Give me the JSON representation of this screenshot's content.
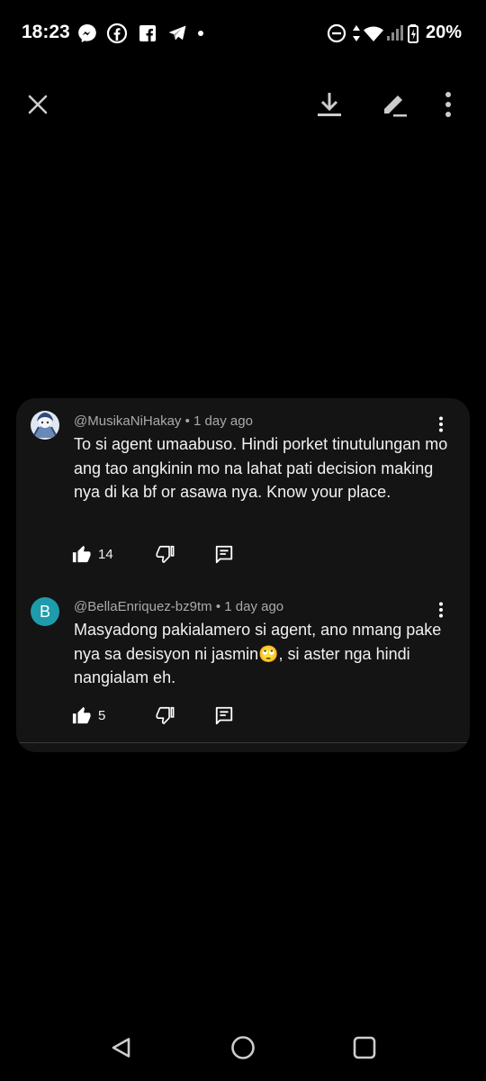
{
  "status_bar": {
    "time": "18:23",
    "notification_icons": [
      "messenger-icon",
      "facebook-icon",
      "facebook-pages-icon",
      "telegram-icon",
      "dot-icon"
    ],
    "system_icons": [
      "dnd-icon",
      "data-arrows-icon",
      "wifi-icon",
      "signal-icon",
      "battery-icon"
    ],
    "battery": "20%"
  },
  "toolbar": {
    "close_icon": "close-icon",
    "download_icon": "download-icon",
    "edit_icon": "edit-icon",
    "more_icon": "more-vert-icon"
  },
  "comments": [
    {
      "author": "@MusikaNiHakay",
      "age": "1 day ago",
      "avatar": "image",
      "text": "To si agent umaabuso.  Hindi porket tinutulungan mo ang tao angkinin mo na lahat pati decision making nya di ka bf or asawa nya.  Know your place.",
      "likes": "14"
    },
    {
      "author": "@BellaEnriquez-bz9tm",
      "age": "1 day ago",
      "avatar": "B",
      "text": "Masyadong pakialamero si agent, ano nmang pake nya sa desisyon ni jasmin🙄, si aster nga hindi nangialam eh.",
      "likes": "5"
    }
  ],
  "separator": "•",
  "nav": {
    "back": "back-icon",
    "home": "home-icon",
    "recents": "recents-icon"
  }
}
